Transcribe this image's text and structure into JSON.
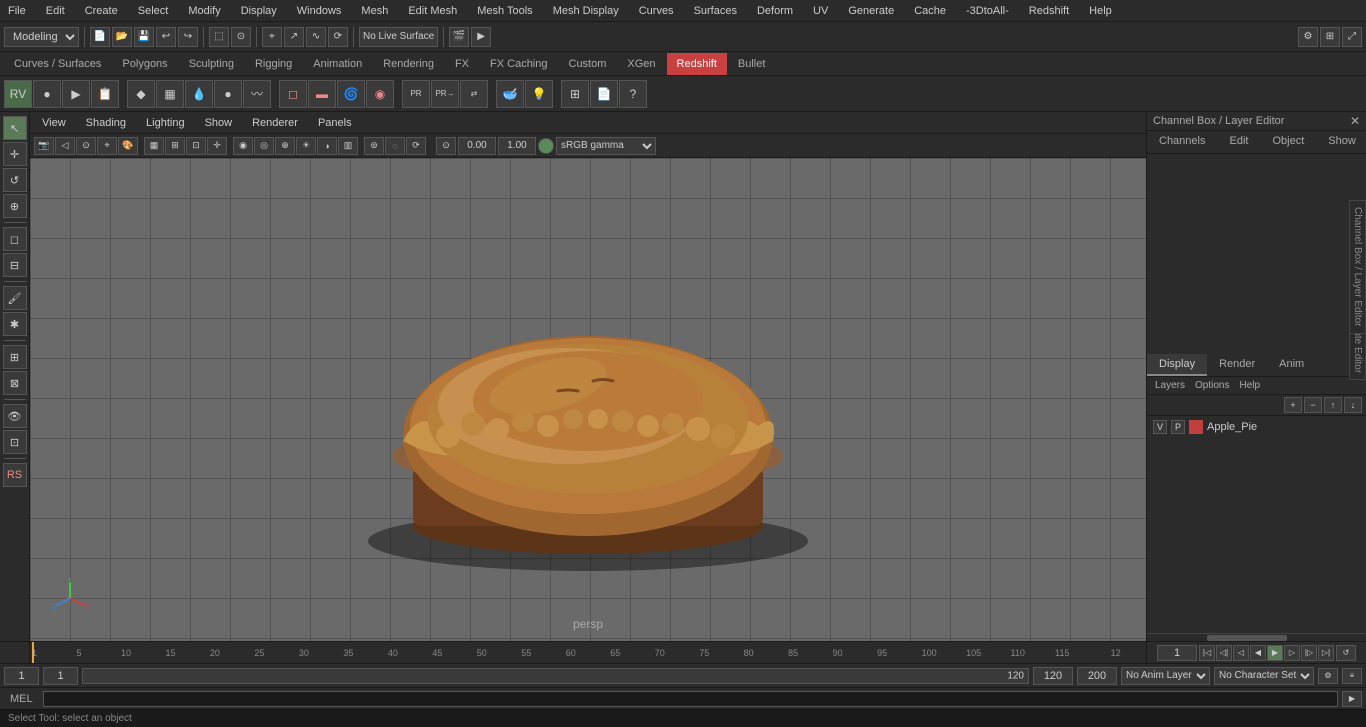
{
  "menubar": {
    "items": [
      "File",
      "Edit",
      "Create",
      "Select",
      "Modify",
      "Display",
      "Windows",
      "Mesh",
      "Edit Mesh",
      "Mesh Tools",
      "Mesh Display",
      "Curves",
      "Surfaces",
      "Deform",
      "UV",
      "Generate",
      "Cache",
      "-3DtoAll-",
      "Redshift",
      "Help"
    ]
  },
  "toolbar1": {
    "mode_label": "Modeling",
    "no_live_surface": "No Live Surface"
  },
  "mode_tabs": {
    "items": [
      "Curves / Surfaces",
      "Polygons",
      "Sculpting",
      "Rigging",
      "Animation",
      "Rendering",
      "FX",
      "FX Caching",
      "Custom",
      "XGen",
      "Redshift",
      "Bullet"
    ]
  },
  "viewport": {
    "menus": [
      "View",
      "Shading",
      "Lighting",
      "Show",
      "Renderer",
      "Panels"
    ],
    "persp_label": "persp",
    "coord_x": "0.00",
    "coord_y": "1.00",
    "color_space": "sRGB gamma"
  },
  "channel_box": {
    "title": "Channel Box / Layer Editor",
    "tabs": [
      "Channels",
      "Edit",
      "Object",
      "Show"
    ]
  },
  "layer_editor": {
    "tabs": [
      "Display",
      "Render",
      "Anim"
    ],
    "options": [
      "Layers",
      "Options",
      "Help"
    ],
    "layer_items": [
      {
        "v": "V",
        "p": "P",
        "color": "#c04040",
        "name": "Apple_Pie"
      }
    ]
  },
  "timeline": {
    "current_frame": "1",
    "start_frame": "1",
    "end_frame": "120",
    "ticks": [
      "1",
      "5",
      "10",
      "15",
      "20",
      "25",
      "30",
      "35",
      "40",
      "45",
      "50",
      "55",
      "60",
      "65",
      "70",
      "75",
      "80",
      "85",
      "90",
      "95",
      "100",
      "105",
      "110",
      "115",
      "12"
    ]
  },
  "timeline_right": {
    "frame": "1"
  },
  "bottom_controls": {
    "start": "1",
    "current": "1",
    "progress_val": "120",
    "end": "120",
    "end2": "200",
    "anim_layer": "No Anim Layer",
    "char_set": "No Character Set"
  },
  "mel_bar": {
    "label": "MEL",
    "placeholder": ""
  },
  "status_bar": {
    "text": "Select Tool: select an object"
  },
  "left_tools": {
    "items": [
      "↖",
      "↔",
      "↺",
      "⊕",
      "◻",
      "⊞",
      "⊟",
      "≡",
      "⚙"
    ]
  }
}
